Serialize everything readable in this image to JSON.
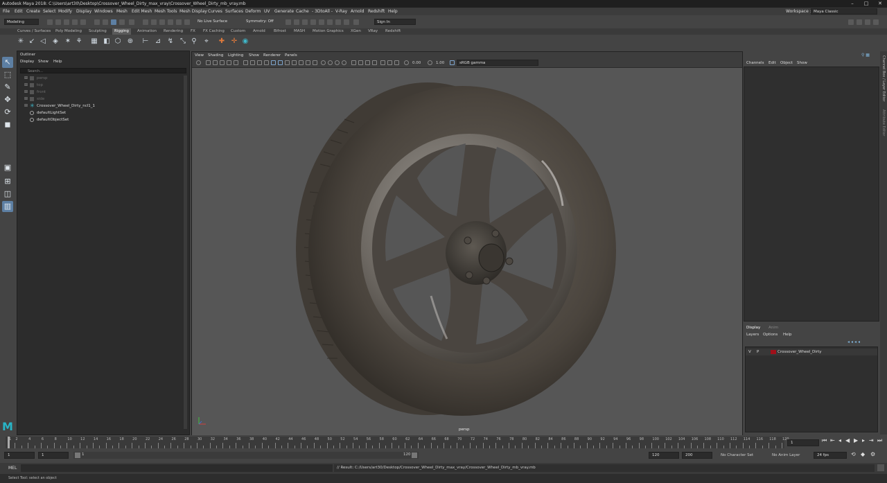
{
  "window": {
    "title": "Autodesk Maya 2018: C:\\Users\\art30\\Desktop\\Crossover_Wheel_Dirty_max_vray\\Crossover_Wheel_Dirty_mb_vray.mb"
  },
  "menu": {
    "items": [
      "File",
      "Edit",
      "Create",
      "Select",
      "Modify",
      "Display",
      "Windows",
      "Mesh",
      "Edit Mesh",
      "Mesh Tools",
      "Mesh Display",
      "Curves",
      "Surfaces",
      "Deform",
      "UV",
      "Generate",
      "Cache",
      "- 3DtoAll -",
      "V-Ray",
      "Arnold",
      "Redshift",
      "Help"
    ]
  },
  "workspace": {
    "label": "Workspace :",
    "value": "Maya Classic"
  },
  "status": {
    "mode": "Modeling",
    "live_surface": "No Live Surface",
    "symmetry": "Symmetry: Off",
    "sign_in": "Sign In"
  },
  "shelf_tabs": [
    "Curves / Surfaces",
    "Poly Modeling",
    "Sculpting",
    "Rigging",
    "Animation",
    "Rendering",
    "FX",
    "FX Caching",
    "Custom",
    "Arnold",
    "Bifrost",
    "MASH",
    "Motion Graphics",
    "XGen",
    "VRay",
    "Redshift"
  ],
  "shelf_active": "Rigging",
  "outliner": {
    "title": "Outliner",
    "menu": [
      "Display",
      "Show",
      "Help"
    ],
    "search_placeholder": "Search...",
    "items": [
      {
        "label": "persp",
        "dim": true
      },
      {
        "label": "top",
        "dim": true
      },
      {
        "label": "front",
        "dim": true
      },
      {
        "label": "side",
        "dim": true
      },
      {
        "label": "Crossover_Wheel_Dirty_ncl1_1",
        "dim": false
      },
      {
        "label": "defaultLightSet",
        "dim": false
      },
      {
        "label": "defaultObjectSet",
        "dim": false
      }
    ]
  },
  "viewport": {
    "menu": [
      "View",
      "Shading",
      "Lighting",
      "Show",
      "Renderer",
      "Panels"
    ],
    "exposure": "0.00",
    "gamma": "1.00",
    "colorspace": "sRGB gamma",
    "camera_label": "persp"
  },
  "channel_box": {
    "menu": [
      "Channels",
      "Edit",
      "Object",
      "Show"
    ]
  },
  "layers": {
    "tabs": [
      "Display",
      "Anim"
    ],
    "menu": [
      "Layers",
      "Options",
      "Help"
    ],
    "row": {
      "v": "V",
      "p": "P",
      "name": "Crossover_Wheel_Dirty",
      "color": "#a0101a"
    }
  },
  "side_tabs": [
    "Channel Box / Layer Editor",
    "Attribute Editor"
  ],
  "timeline": {
    "ticks": [
      "1",
      "2",
      "4",
      "6",
      "8",
      "10",
      "12",
      "14",
      "16",
      "18",
      "20",
      "22",
      "24",
      "26",
      "28",
      "30",
      "32",
      "34",
      "36",
      "38",
      "40",
      "42",
      "44",
      "46",
      "48",
      "50",
      "52",
      "54",
      "56",
      "58",
      "60",
      "62",
      "64",
      "66",
      "68",
      "70",
      "72",
      "74",
      "76",
      "78",
      "80",
      "82",
      "84",
      "86",
      "88",
      "90",
      "92",
      "94",
      "96",
      "98",
      "100",
      "102",
      "104",
      "106",
      "108",
      "110",
      "112",
      "114",
      "116",
      "118",
      "120"
    ],
    "current_frame": "1"
  },
  "range": {
    "start": "1",
    "playback_start": "1",
    "slider_start": "1",
    "slider_end": "120",
    "playback_end": "120",
    "end": "200",
    "character_set": "No Character Set",
    "anim_layer": "No Anim Layer",
    "fps": "24 fps"
  },
  "command": {
    "lang": "MEL",
    "result": "// Result: C:/Users/art30/Desktop/Crossover_Wheel_Dirty_max_vray/Crossover_Wheel_Dirty_mb_vray.mb"
  },
  "help_line": "Select Tool: select an object",
  "colors": {
    "accent": "#5d7fa3",
    "layer_color": "#a0101a",
    "viewport_bg": "#565656"
  }
}
